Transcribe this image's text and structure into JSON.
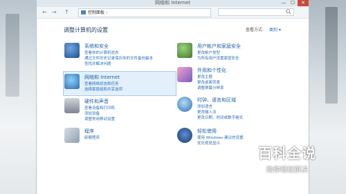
{
  "window": {
    "title": "网络和 Internet",
    "close": "✕",
    "maximize": "☐",
    "minimize": "—"
  },
  "address": {
    "back": "←",
    "forward": "→",
    "up": "↑",
    "path": "控制面板",
    "search_icon": "search-icon"
  },
  "header": {
    "title": "调整计算机的设置",
    "view_by_label": "查看方式:",
    "view_by_value": "类别 ▾"
  },
  "categories": [
    {
      "title": "系统和安全",
      "links": [
        "查看你的计算机状态",
        "通过文件历史记录保存你的文件备份副本",
        "查找并解决问题"
      ],
      "icon": "shield-icon",
      "color": "#2e6db4"
    },
    {
      "title": "网络和 Internet",
      "links": [
        "查看网络状态和任务",
        "选择家庭组和共享选项"
      ],
      "icon": "network-globe-icon",
      "color": "#3a8bd1"
    },
    {
      "title": "硬件和声音",
      "links": [
        "查看设备和打印机",
        "添加设备",
        "调整常用移动设置"
      ],
      "icon": "printer-icon",
      "color": "#6e7b86"
    },
    {
      "title": "程序",
      "links": [
        "卸载程序"
      ],
      "icon": "programs-icon",
      "color": "#7b8e9f"
    },
    {
      "title": "用户帐户和家庭安全",
      "links": [
        "更改帐户类型",
        "为所有用户设置家庭安全"
      ],
      "icon": "users-icon",
      "color": "#3f8a3c"
    },
    {
      "title": "外观和个性化",
      "links": [
        "更改主题",
        "更改桌面背景",
        "调整屏幕分辨率"
      ],
      "icon": "appearance-icon",
      "color": "#c04a7a"
    },
    {
      "title": "时钟、语言和区域",
      "links": [
        "添加语言",
        "更改输入法",
        "更改日期、时间或数字格式"
      ],
      "icon": "clock-globe-icon",
      "color": "#2a6fb0"
    },
    {
      "title": "轻松使用",
      "links": [
        "使用 Windows 建议的设置",
        "优化视觉显示"
      ],
      "icon": "accessibility-icon",
      "color": "#1f4f8f"
    }
  ],
  "watermark": {
    "line1": "百科全说",
    "line2": "助你轻松解决"
  }
}
